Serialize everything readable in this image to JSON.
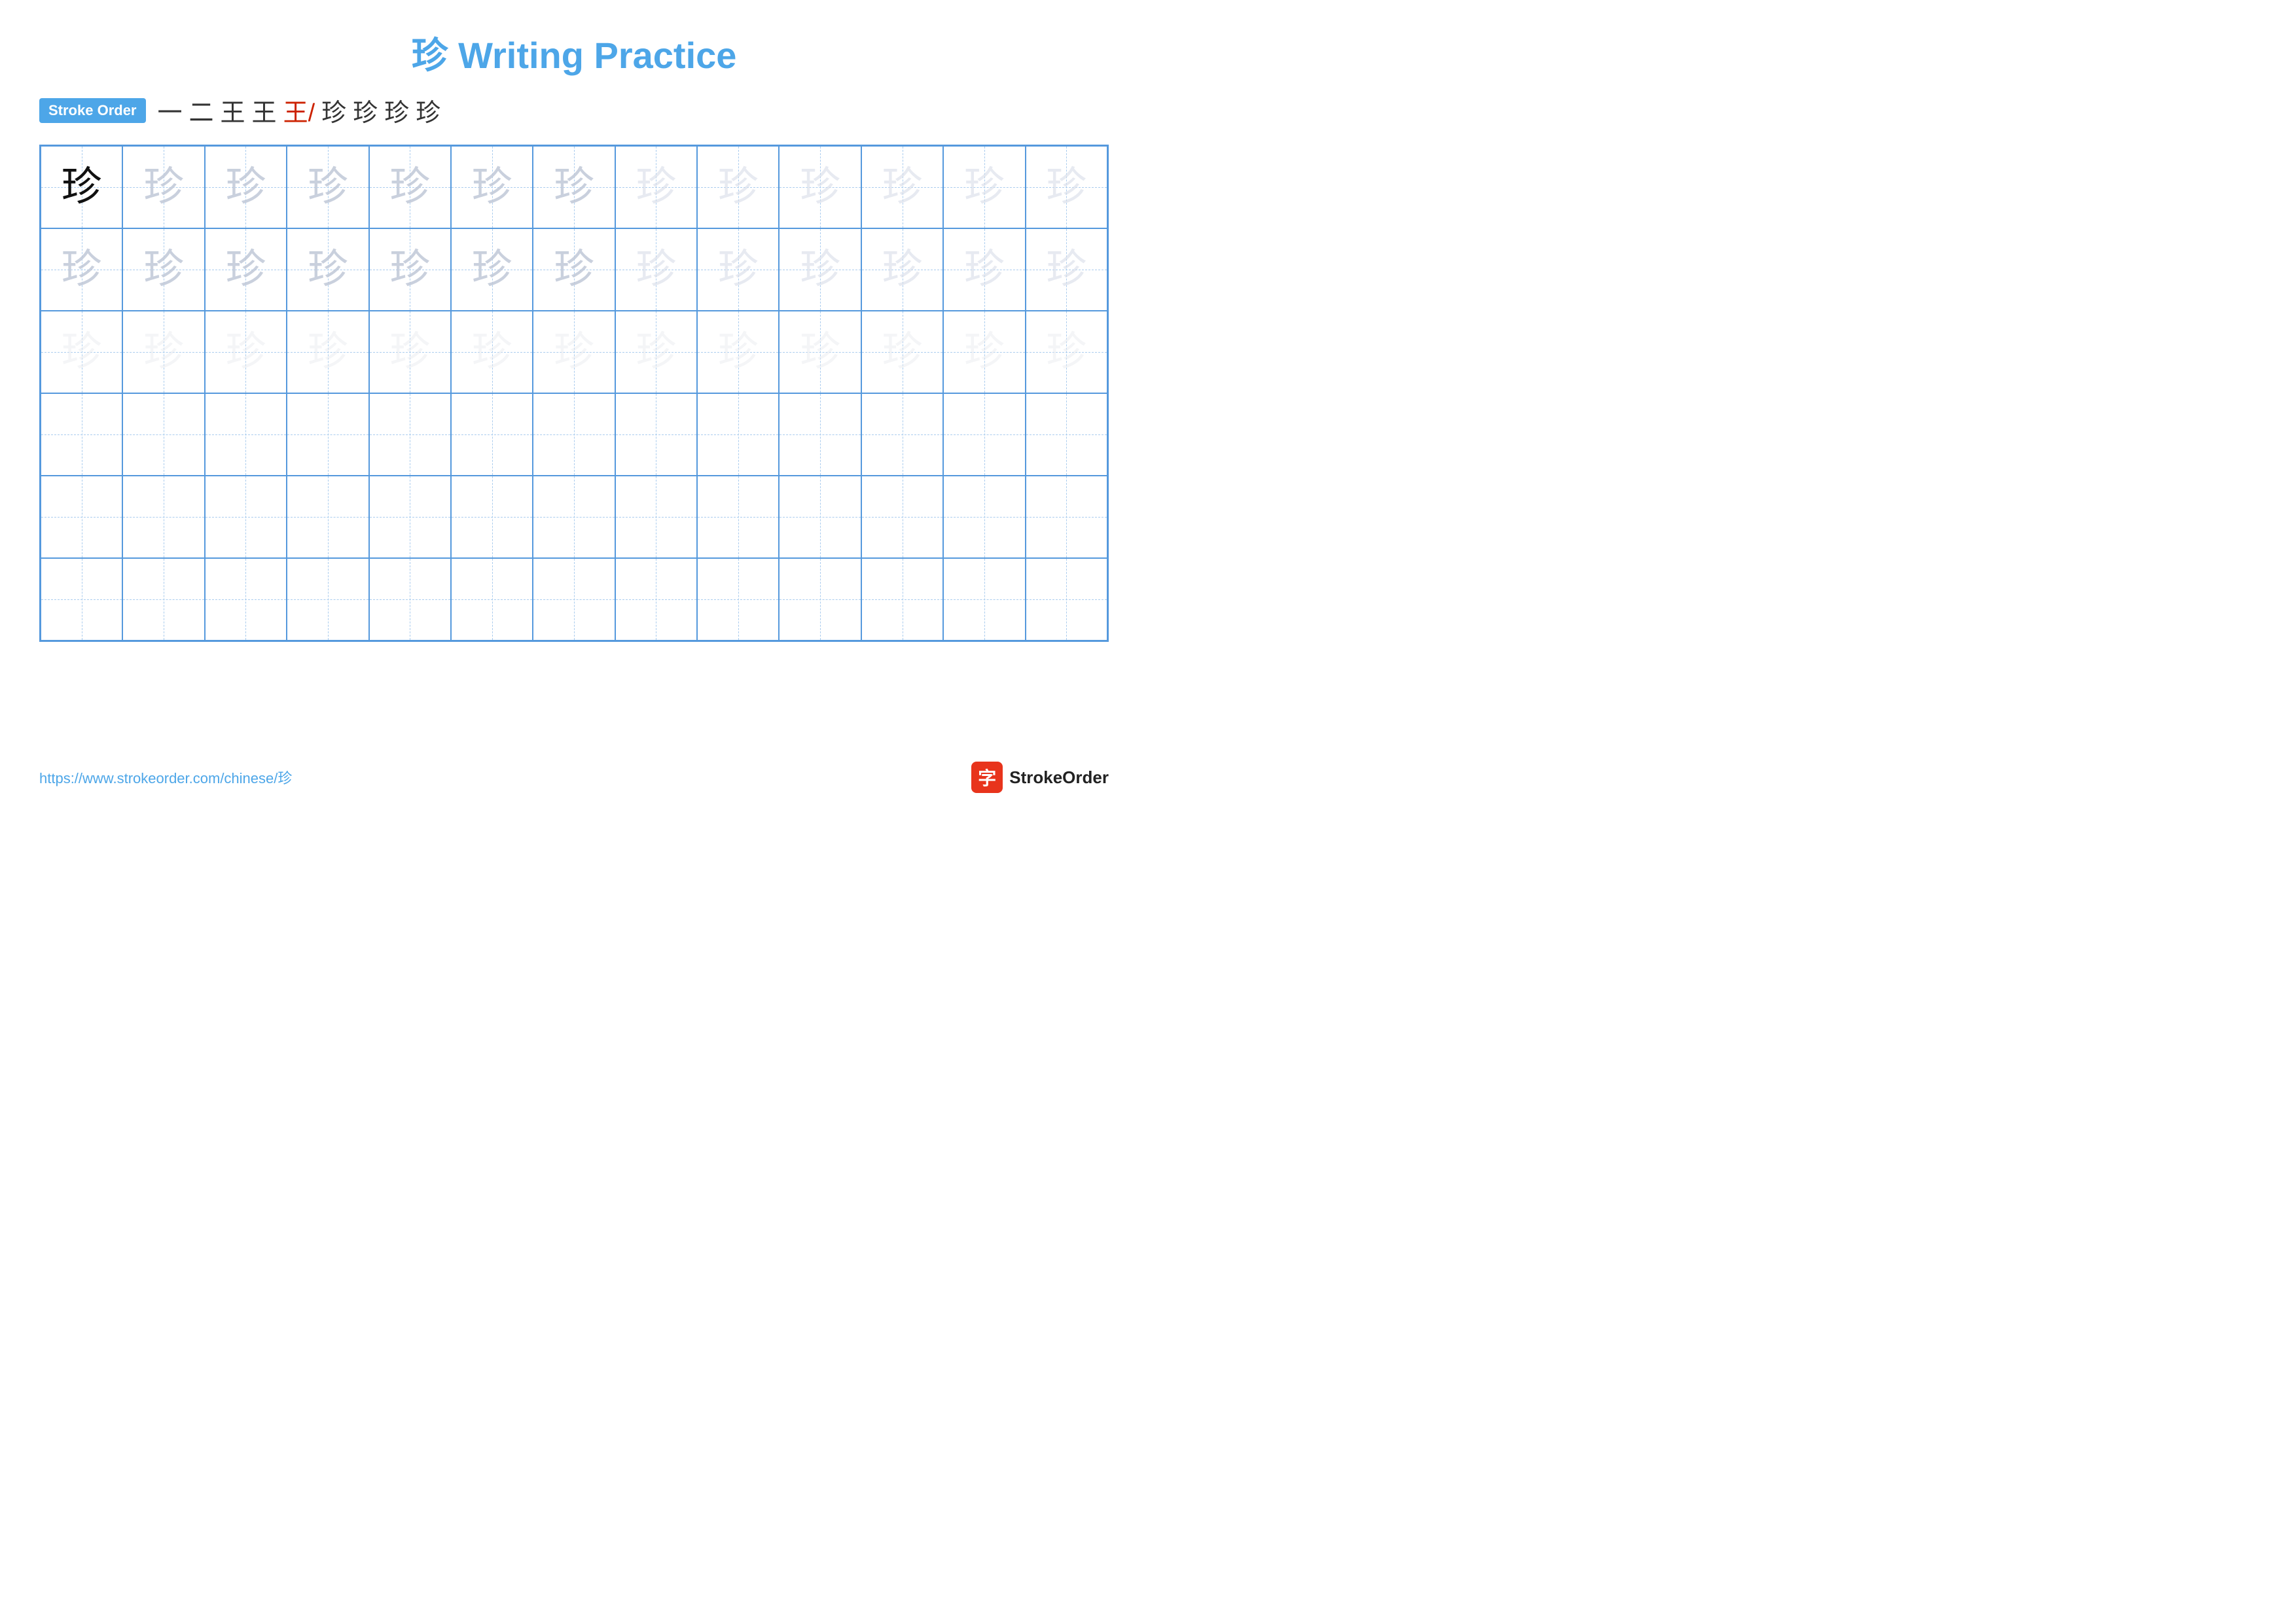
{
  "page": {
    "title": "珍 Writing Practice",
    "stroke_order_label": "Stroke Order",
    "stroke_sequence": [
      "一",
      "二",
      "王",
      "王",
      "王/",
      "珍",
      "珍",
      "珍",
      "珍"
    ],
    "character": "珍",
    "footer_url": "https://www.strokeorder.com/chinese/珍",
    "footer_logo_text": "StrokeOrder",
    "footer_logo_icon": "字",
    "grid": {
      "cols": 13,
      "rows": 6
    }
  }
}
